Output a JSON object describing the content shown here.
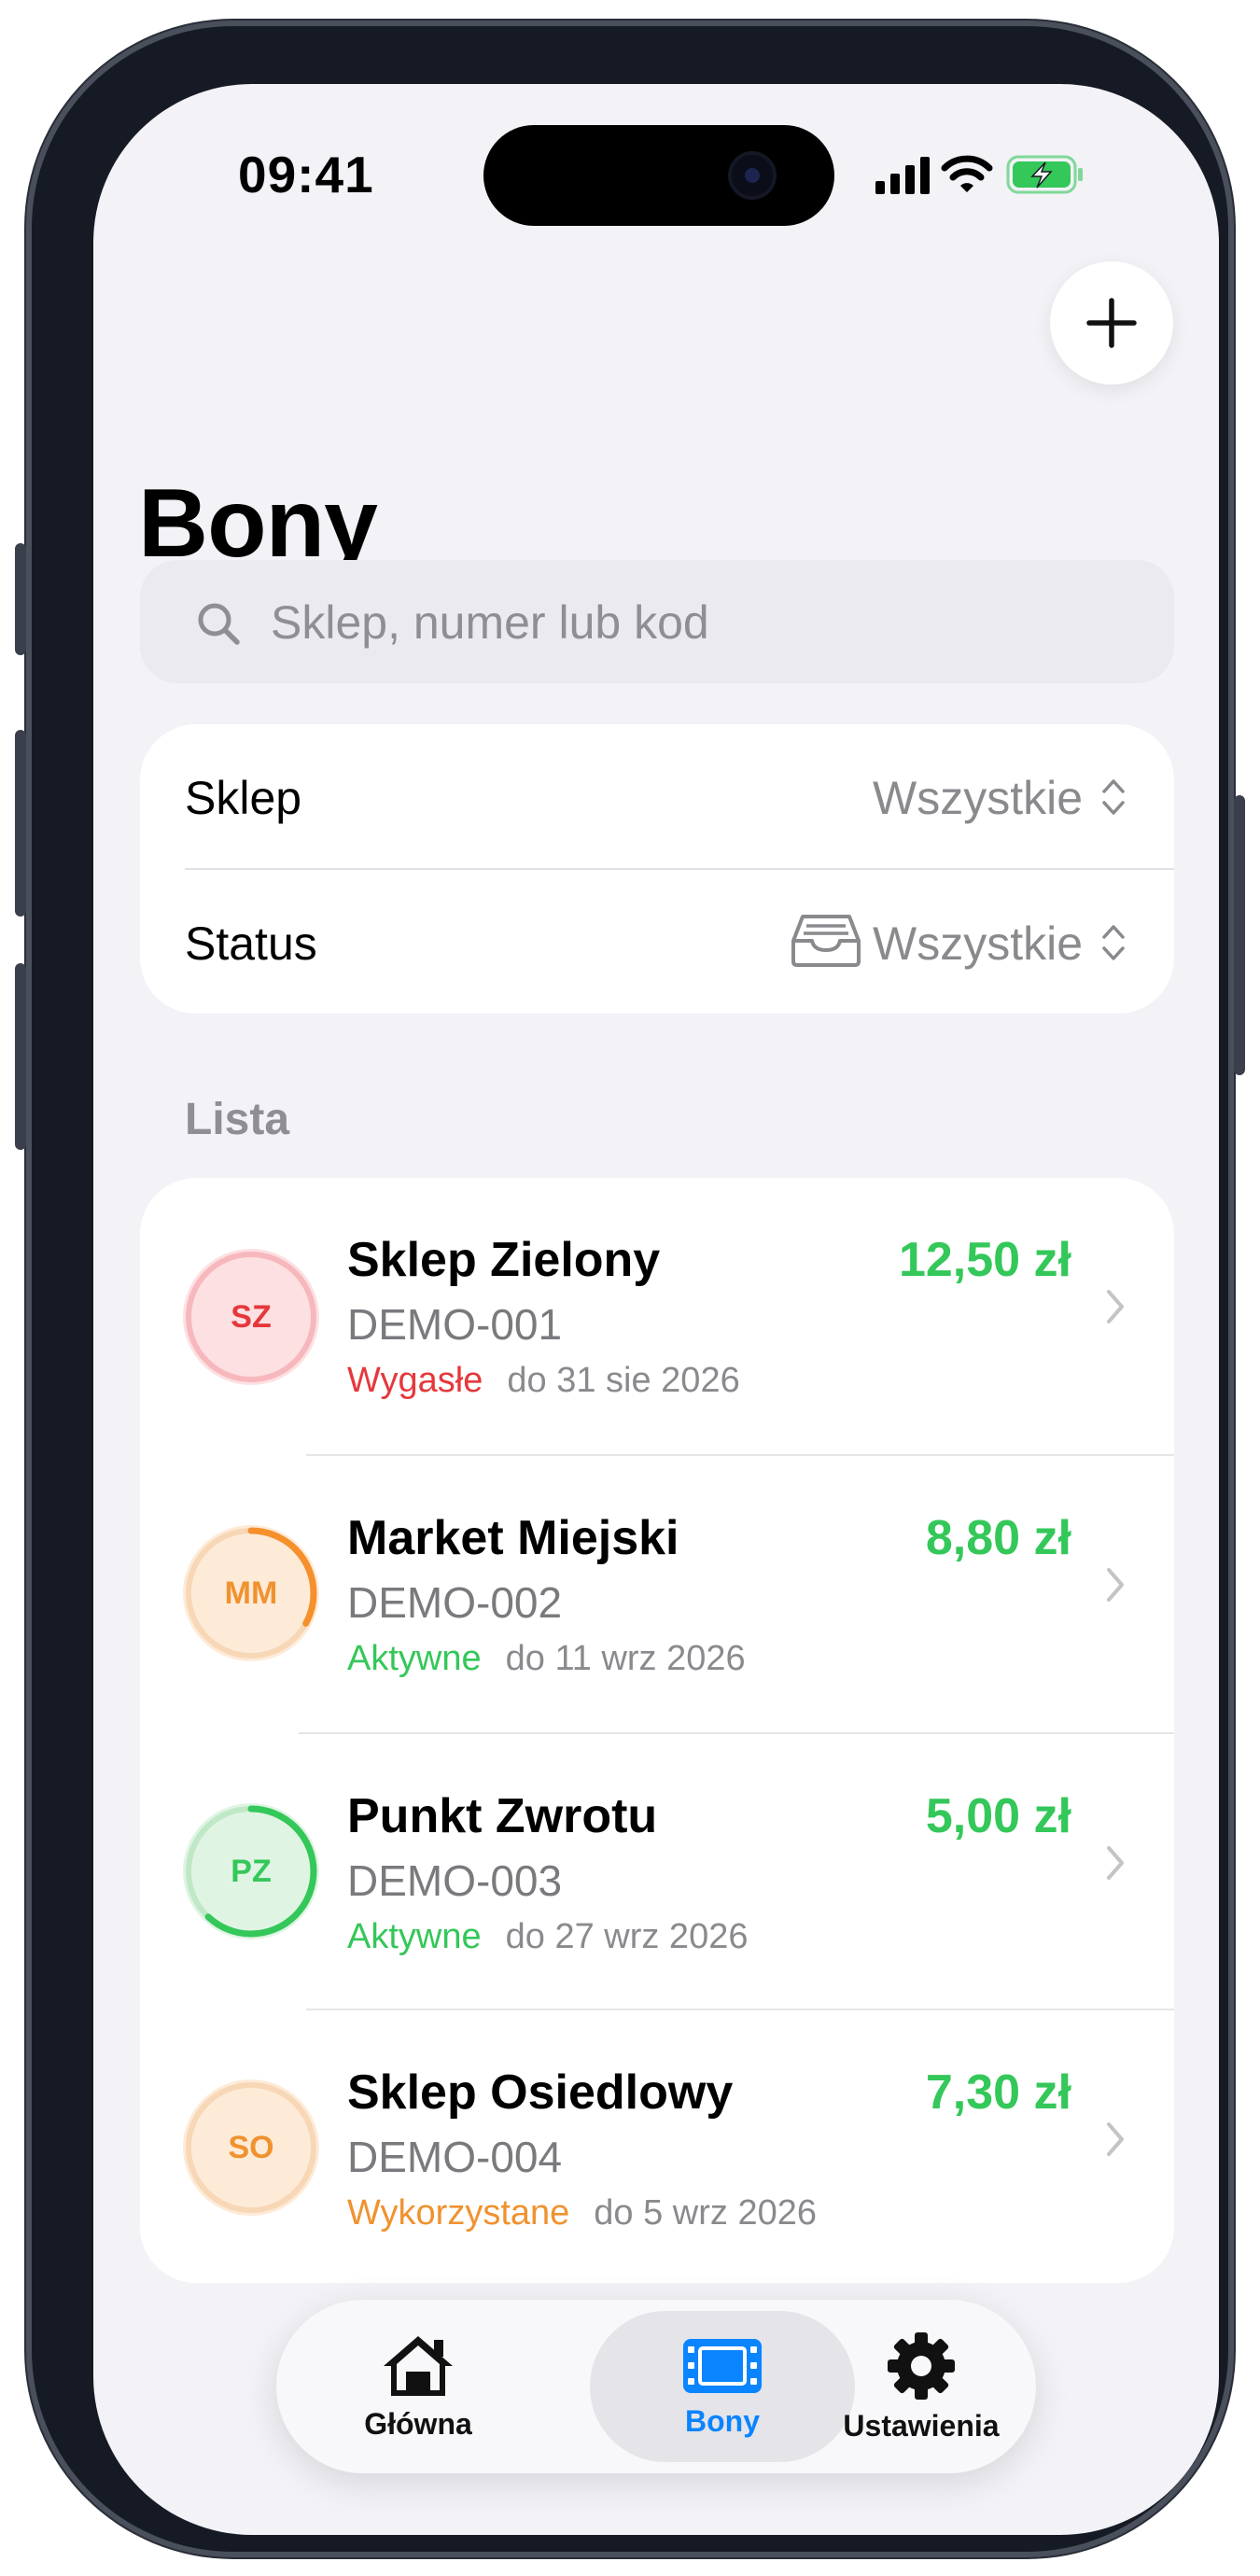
{
  "status_bar": {
    "time": "09:41"
  },
  "header": {
    "title": "Bony",
    "add_icon": "plus-icon"
  },
  "search": {
    "placeholder": "Sklep, numer lub kod",
    "icon": "search-icon"
  },
  "filters": {
    "shop": {
      "label": "Sklep",
      "value": "Wszystkie"
    },
    "status": {
      "label": "Status",
      "value": "Wszystkie",
      "icon": "tray-icon"
    }
  },
  "list": {
    "section_label": "Lista",
    "items": [
      {
        "initials": "SZ",
        "name": "Sklep Zielony",
        "code": "DEMO-001",
        "amount": "12,50 zł",
        "status": "Wygasłe",
        "date": "do 31 sie 2026",
        "status_color": "#e5383b",
        "avatar_bg": "#fde0e2",
        "ring_color": "#f6b8bd",
        "progress": 0
      },
      {
        "initials": "MM",
        "name": "Market Miejski",
        "code": "DEMO-002",
        "amount": "8,80 zł",
        "status": "Aktywne",
        "date": "do 11 wrz 2026",
        "status_color": "#34c759",
        "avatar_bg": "#fdebd8",
        "ring_color": "#f7d7b6",
        "arc_color": "#f5902c",
        "progress": 0.33
      },
      {
        "initials": "PZ",
        "name": "Punkt Zwrotu",
        "code": "DEMO-003",
        "amount": "5,00 zł",
        "status": "Aktywne",
        "date": "do 27 wrz 2026",
        "status_color": "#34c759",
        "avatar_bg": "#e0f4e3",
        "ring_color": "#bfe8c6",
        "arc_color": "#34c759",
        "progress": 0.62
      },
      {
        "initials": "SO",
        "name": "Sklep Osiedlowy",
        "code": "DEMO-004",
        "amount": "7,30 zł",
        "status": "Wykorzystane",
        "date": "do 5 wrz 2026",
        "status_color": "#f0922f",
        "avatar_bg": "#fdebd8",
        "ring_color": "#f7d7b6",
        "progress": 0
      }
    ]
  },
  "tabbar": {
    "tabs": [
      {
        "label": "Główna",
        "icon": "house-icon"
      },
      {
        "label": "Bony",
        "icon": "ticket-icon",
        "active": true
      },
      {
        "label": "Ustawienia",
        "icon": "gear-icon"
      }
    ],
    "active_color": "#0a84ff"
  }
}
